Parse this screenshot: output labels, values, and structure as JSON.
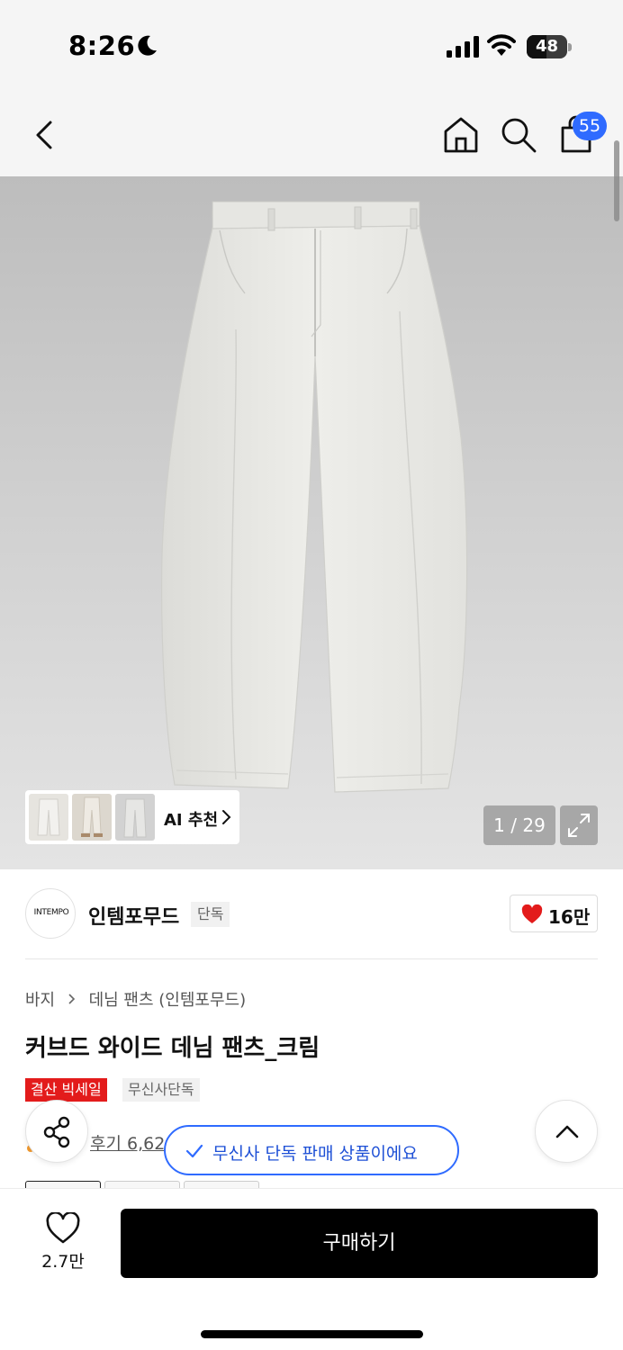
{
  "status_bar": {
    "time": "8:26",
    "battery": "48",
    "battery_level": 0.48
  },
  "header": {
    "back_icon": "chevron-left-icon",
    "home_icon": "home-icon",
    "search_icon": "search-icon",
    "cart_icon": "shopping-bag-icon",
    "cart_badge": "55",
    "badge_color": "#2f6bff"
  },
  "gallery": {
    "ai_label": "AI 추천",
    "counter": "1 / 29",
    "expand_icon": "expand-icon"
  },
  "brand": {
    "logo_text": "INTEMPO",
    "name": "인템포무드",
    "tag": "단독",
    "likes": "16만",
    "heart_color": "#e31b1b"
  },
  "product": {
    "breadcrumb": [
      "바지",
      "데님 팬츠 (인템포무드)"
    ],
    "title": "커브드 와이드 데님 팬츠_크림",
    "badges": {
      "sale": "결산 빅세일",
      "exclusive": "무신사단독"
    },
    "review": "후기 6,62",
    "sale_color": "#e31b1b"
  },
  "toast": {
    "text": "무신사 단독 판매 상품이에요",
    "color": "#2f6bff"
  },
  "bottom_bar": {
    "wish_count": "2.7만",
    "buy_label": "구매하기"
  }
}
